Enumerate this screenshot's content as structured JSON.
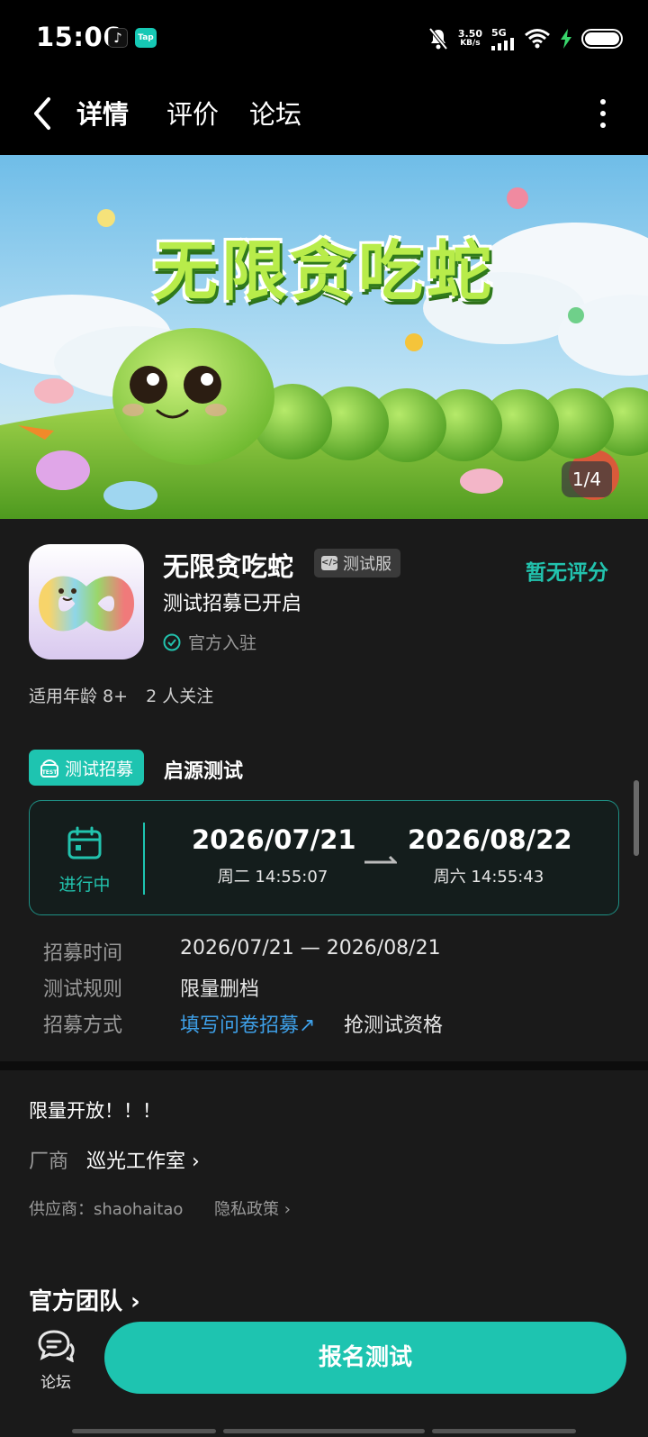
{
  "status_bar": {
    "time": "15:06",
    "app_icon_1": "♪",
    "app_icon_2": "Tap",
    "net_speed_value": "3.50",
    "net_speed_unit": "KB/s",
    "network": "5G",
    "icons": [
      "bell-off-icon",
      "signal-icon",
      "wifi-icon",
      "charging-icon",
      "battery-icon"
    ]
  },
  "nav": {
    "tabs": [
      {
        "label": "详情",
        "active": true
      },
      {
        "label": "评价",
        "active": false
      },
      {
        "label": "论坛",
        "active": false
      }
    ]
  },
  "banner": {
    "title": "无限贪吃蛇",
    "counter": "1/4"
  },
  "app": {
    "name": "无限贪吃蛇",
    "badge": "测试服",
    "rating": "暂无评分",
    "subtitle": "测试招募已开启",
    "official": "官方入驻",
    "age": "适用年龄 8+",
    "followers": "2 人关注"
  },
  "recruit": {
    "chip_label": "测试招募",
    "title": "启源测试",
    "status": "进行中",
    "start_date": "2026/07/21",
    "start_time": "周二  14:55:07",
    "end_date": "2026/08/22",
    "end_time": "周六  14:55:43",
    "rows": [
      {
        "key": "招募时间",
        "value": "2026/07/21 — 2026/08/21"
      },
      {
        "key": "测试规则",
        "value": "限量删档"
      },
      {
        "key": "招募方式",
        "value": "填写问卷招募↗",
        "extra": "抢测试资格"
      }
    ]
  },
  "info": {
    "notice": "限量开放！！！",
    "vendor_label": "厂商",
    "vendor_name": "巡光工作室 ›",
    "supplier": "供应商：shaohaitao",
    "privacy": "隐私政策 ›",
    "team": "官方团队 ›"
  },
  "bottom": {
    "forum_label": "论坛",
    "signup": "报名测试"
  },
  "colors": {
    "accent": "#1ec4b0",
    "link": "#3ea0e8",
    "background": "#1a1a1a"
  }
}
